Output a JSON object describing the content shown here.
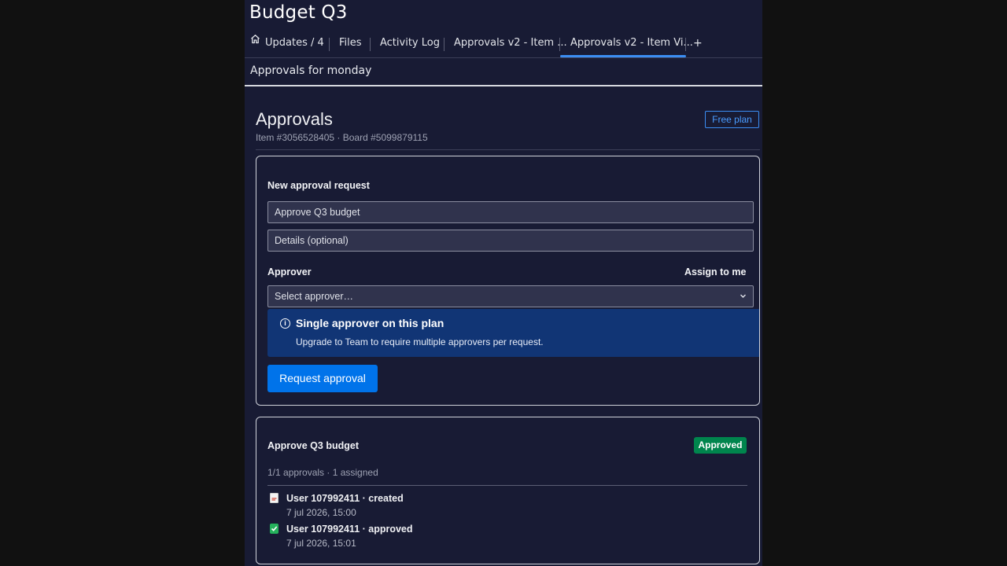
{
  "board": {
    "title": "Budget Q3"
  },
  "tabs": [
    {
      "label": "Updates / 4",
      "icon": "home-icon"
    },
    {
      "label": "Files"
    },
    {
      "label": "Activity Log"
    },
    {
      "label": "Approvals v2 - Item ..."
    },
    {
      "label": "Approvals v2 - Item Vi...",
      "active": true
    },
    {
      "label": "+"
    }
  ],
  "app": {
    "subtitle": "Approvals for monday",
    "heading": "Approvals",
    "meta": "Item #3056528405 · Board #5099879115",
    "plan_badge": "Free plan"
  },
  "new_request": {
    "section_title": "New approval request",
    "title_value": "Approve Q3 budget",
    "details_placeholder": "Details (optional)",
    "approver_label": "Approver",
    "assign_to_me": "Assign to me",
    "approver_select": "Select approver…",
    "banner": {
      "title": "Single approver on this plan",
      "text": "Upgrade to Team to require multiple approvers per request.",
      "icon": "info-icon"
    },
    "submit_label": "Request approval"
  },
  "request": {
    "title": "Approve Q3 budget",
    "status": "Approved",
    "meta": "1/1 approvals · 1 assigned",
    "activity": [
      {
        "icon": "document-icon",
        "text": "User 107992411 · created",
        "date": "7 jul 2026, 15:00"
      },
      {
        "icon": "check-box-icon",
        "text": "User 107992411 · approved",
        "date": "7 jul 2026, 15:01"
      }
    ]
  },
  "colors": {
    "panel_bg": "#181b34",
    "accent": "#0073ea",
    "approved": "#00854d",
    "banner_bg": "#113575"
  }
}
